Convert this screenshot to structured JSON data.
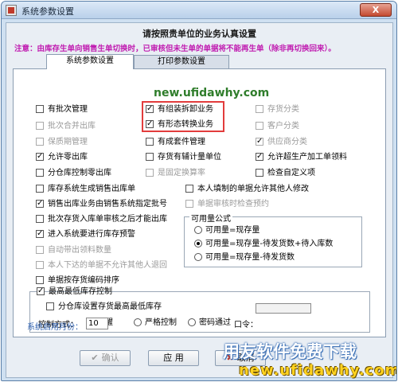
{
  "window": {
    "title": "系统参数设置",
    "close_label": "X"
  },
  "heading": "请按照贵单位的业务认真设置",
  "notice": "注意：由库存生单向销售生单切换时，已审核但未生单的单据将不能再生单（除非再切换回来）。",
  "tabs": [
    {
      "label": "系统参数设置",
      "active": true
    },
    {
      "label": "打印参数设置",
      "active": false
    }
  ],
  "watermark_text": "new.ufidawhy.com",
  "options": {
    "batch_mgmt": {
      "label": "有批次管理",
      "checked": false,
      "enabled": true
    },
    "batch_merge_out": {
      "label": "批次合并出库",
      "checked": false,
      "enabled": false
    },
    "shelf_life_mgmt": {
      "label": "保质期管理",
      "checked": false,
      "enabled": false
    },
    "allow_zero_out": {
      "label": "允许零出库",
      "checked": true,
      "enabled": true
    },
    "warehouse_zero_out": {
      "label": "分仓库控制零出库",
      "checked": false,
      "enabled": true
    },
    "assembly_disassembly": {
      "label": "有组装拆卸业务",
      "checked": true,
      "enabled": true
    },
    "form_conversion": {
      "label": "有形态转换业务",
      "checked": true,
      "enabled": true
    },
    "kit_mgmt": {
      "label": "有成套件管理",
      "checked": false,
      "enabled": true
    },
    "aux_measure": {
      "label": "存货有辅计量单位",
      "checked": false,
      "enabled": true
    },
    "fixed_conversion": {
      "label": "是固定换算率",
      "checked": false,
      "enabled": false
    },
    "inventory_category": {
      "label": "存货分类",
      "checked": false,
      "enabled": false
    },
    "customer_category": {
      "label": "客户分类",
      "checked": false,
      "enabled": false
    },
    "vendor_category": {
      "label": "供应商分类",
      "checked": true,
      "enabled": false
    },
    "allow_over_production": {
      "label": "允许超生产加工单领料",
      "checked": true,
      "enabled": true
    },
    "check_custom_items": {
      "label": "检查自定义项",
      "checked": false,
      "enabled": true
    },
    "auto_sales_out": {
      "label": "库存系统生成销售出库单",
      "checked": false,
      "enabled": true
    },
    "sales_batch_by_sales": {
      "label": "销售出库业务由销售系统指定批号",
      "checked": true,
      "enabled": true
    },
    "batch_after_audit": {
      "label": "批次存货入库单审核之后才能出库",
      "checked": false,
      "enabled": true
    },
    "inventory_warning": {
      "label": "进入系统要进行库存预警",
      "checked": true,
      "enabled": true
    },
    "auto_picking_qty": {
      "label": "自动带出领料数量",
      "checked": false,
      "enabled": false
    },
    "own_docs_only": {
      "label": "本人下达的单据不允许其他人退回",
      "checked": false,
      "enabled": false
    },
    "sort_by_code": {
      "label": "单据按存货编码排序",
      "checked": false,
      "enabled": true
    },
    "allow_others_edit": {
      "label": "本人填制的单据允许其他人修改",
      "checked": false,
      "enabled": true
    },
    "audit_check_reservation": {
      "label": "单据审核时检查预约",
      "checked": false,
      "enabled": false
    }
  },
  "available_qty": {
    "title": "可用量公式",
    "options": [
      {
        "label": "可用量=现存量",
        "selected": false
      },
      {
        "label": "可用量=现存量-待发货数+待入库数",
        "selected": true
      },
      {
        "label": "可用量=现存量-待发货数",
        "selected": false
      }
    ]
  },
  "min_stock": {
    "enable": {
      "label": "最高最低库存控制",
      "checked": true
    },
    "by_warehouse": {
      "label": "分仓库设置存货最高最低库存",
      "checked": false
    },
    "control_mode_label": "控制方式：",
    "modes": [
      {
        "label": "提醒",
        "selected": true
      },
      {
        "label": "严格控制",
        "selected": false
      },
      {
        "label": "密码通过",
        "selected": false
      }
    ],
    "password_label": "口令："
  },
  "start_month": {
    "label": "系统启用月份：",
    "value": "10"
  },
  "buttons": {
    "confirm": {
      "label": "确认",
      "enabled": false
    },
    "apply": {
      "label": "应 用",
      "enabled": true
    },
    "cancel": {
      "label": "取消",
      "enabled": true
    }
  },
  "branding": {
    "cn": "用友软件免费下载",
    "url": "new.ufidawhy.com"
  }
}
